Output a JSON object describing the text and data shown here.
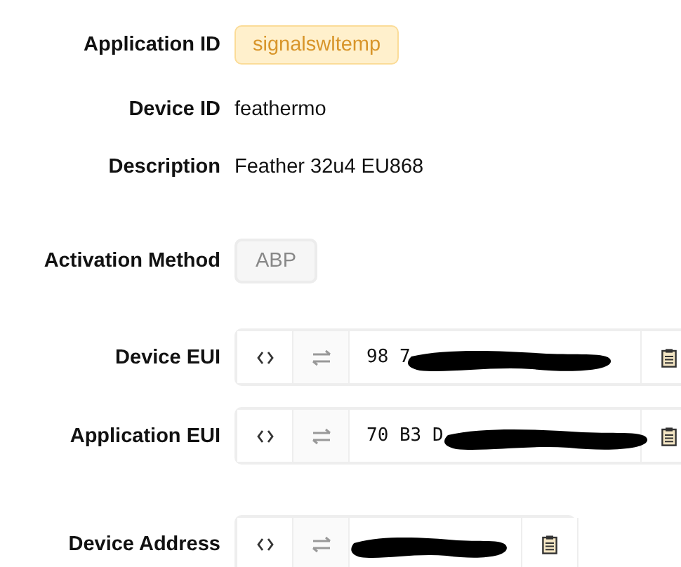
{
  "fields": [
    {
      "kind": "badge",
      "label": "Application ID",
      "value": "signalswltemp"
    },
    {
      "kind": "text",
      "label": "Device ID",
      "value": "feathermo"
    },
    {
      "kind": "text",
      "label": "Description",
      "value": "Feather 32u4 EU868"
    },
    {
      "kind": "chip",
      "label": "Activation Method",
      "value": "ABP"
    },
    {
      "kind": "hex",
      "label": "Device EUI",
      "value": "98 7",
      "redacted": true,
      "wide": true
    },
    {
      "kind": "hex",
      "label": "Application EUI",
      "value": "70 B3 D",
      "redacted": true,
      "wide": true
    },
    {
      "kind": "hex",
      "label": "Device Address",
      "redacted": true,
      "wide": false
    }
  ]
}
